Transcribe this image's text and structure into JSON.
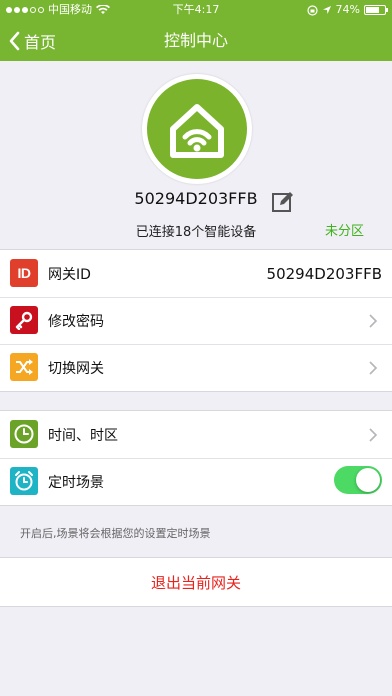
{
  "status_bar": {
    "carrier": "中国移动",
    "time": "下午4:17",
    "battery": "74%",
    "battery_level": 0.74
  },
  "nav": {
    "back_label": "首页",
    "title": "控制中心"
  },
  "gateway": {
    "id": "50294D203FFB",
    "connected_text": "已连接18个智能设备",
    "zone_label": "未分区"
  },
  "settings_group_1": {
    "items": [
      {
        "label": "网关ID",
        "value": "50294D203FFB",
        "icon": "id-icon",
        "color": "#e0402b"
      },
      {
        "label": "修改密码",
        "icon": "key-icon",
        "color": "#c8101e"
      },
      {
        "label": "切换网关",
        "icon": "shuffle-icon",
        "color": "#f5a623"
      }
    ]
  },
  "settings_group_2": {
    "items": [
      {
        "label": "时间、时区",
        "icon": "clock-icon",
        "color": "#6aa328"
      },
      {
        "label": "定时场景",
        "icon": "alarm-clock-icon",
        "color": "#1fb3c6",
        "toggle_on": true
      }
    ]
  },
  "hint": "开启后,场景将会根据您的设置定时场景",
  "logout_label": "退出当前网关",
  "colors": {
    "header_green": "#78b530",
    "toggle_green": "#4cd964",
    "zone_green": "#3fb21d",
    "logout_red": "#e8231c"
  }
}
